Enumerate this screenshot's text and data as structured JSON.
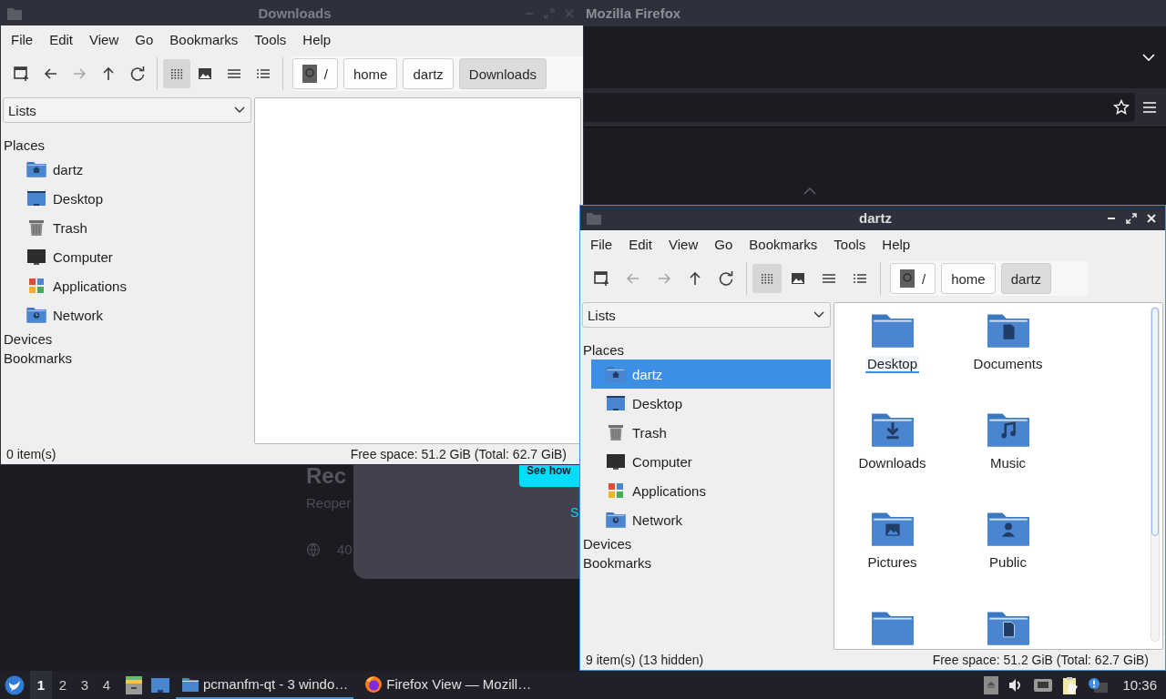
{
  "firefox": {
    "title": "Mozilla Firefox",
    "page": {
      "heading": "Rec",
      "subtitle": "Reoper",
      "count": "40",
      "popup": {
        "button": "See how",
        "link": "S"
      }
    }
  },
  "file_windows": [
    {
      "title": "Downloads",
      "active": false,
      "menu": [
        "File",
        "Edit",
        "View",
        "Go",
        "Bookmarks",
        "Tools",
        "Help"
      ],
      "nav": {
        "back_enabled": true,
        "forward_enabled": false
      },
      "view_buttons": [
        {
          "selected": true
        },
        {
          "selected": false
        },
        {
          "selected": false
        },
        {
          "selected": false
        }
      ],
      "path": [
        {
          "label": "/",
          "selected": false
        },
        {
          "label": "home",
          "selected": false
        },
        {
          "label": "dartz",
          "selected": false
        },
        {
          "label": "Downloads",
          "selected": true
        }
      ],
      "sidebar": {
        "combo": "Lists",
        "places_label": "Places",
        "places": [
          {
            "label": "dartz",
            "kind": "home",
            "selected": false
          },
          {
            "label": "Desktop",
            "kind": "desktop",
            "selected": false
          },
          {
            "label": "Trash",
            "kind": "trash",
            "selected": false
          },
          {
            "label": "Computer",
            "kind": "computer",
            "selected": false
          },
          {
            "label": "Applications",
            "kind": "applications",
            "selected": false
          },
          {
            "label": "Network",
            "kind": "network",
            "selected": false
          }
        ],
        "sections": [
          "Devices",
          "Bookmarks"
        ]
      },
      "status": {
        "count": "0 item(s)",
        "free": "Free space: 51.2 GiB (Total: 62.7 GiB)"
      }
    },
    {
      "title": "dartz",
      "active": true,
      "menu": [
        "File",
        "Edit",
        "View",
        "Go",
        "Bookmarks",
        "Tools",
        "Help"
      ],
      "nav": {
        "back_enabled": false,
        "forward_enabled": false
      },
      "view_buttons": [
        {
          "selected": true
        },
        {
          "selected": false
        },
        {
          "selected": false
        },
        {
          "selected": false
        }
      ],
      "path": [
        {
          "label": "/",
          "selected": false
        },
        {
          "label": "home",
          "selected": false
        },
        {
          "label": "dartz",
          "selected": true
        }
      ],
      "sidebar": {
        "combo": "Lists",
        "places_label": "Places",
        "places": [
          {
            "label": "dartz",
            "kind": "home",
            "selected": true
          },
          {
            "label": "Desktop",
            "kind": "desktop",
            "selected": false
          },
          {
            "label": "Trash",
            "kind": "trash",
            "selected": false
          },
          {
            "label": "Computer",
            "kind": "computer",
            "selected": false
          },
          {
            "label": "Applications",
            "kind": "applications",
            "selected": false
          },
          {
            "label": "Network",
            "kind": "network",
            "selected": false
          }
        ],
        "sections": [
          "Devices",
          "Bookmarks"
        ]
      },
      "files": [
        {
          "name": "Desktop",
          "kind": "desktop",
          "focused": true
        },
        {
          "name": "Documents",
          "kind": "documents",
          "focused": false
        },
        {
          "name": "Downloads",
          "kind": "downloads",
          "focused": false
        },
        {
          "name": "Music",
          "kind": "music",
          "focused": false
        },
        {
          "name": "Pictures",
          "kind": "pictures",
          "focused": false
        },
        {
          "name": "Public",
          "kind": "public",
          "focused": false
        },
        {
          "kind": "folder"
        },
        {
          "kind": "templates"
        }
      ],
      "status": {
        "count": "9 item(s) (13 hidden)",
        "free": "Free space: 51.2 GiB (Total: 62.7 GiB)"
      }
    }
  ],
  "taskbar": {
    "workspaces": [
      {
        "label": "1",
        "selected": true
      },
      {
        "label": "2",
        "selected": false
      },
      {
        "label": "3",
        "selected": false
      },
      {
        "label": "4",
        "selected": false
      }
    ],
    "tasks": [
      {
        "label": "pcmanfm-qt - 3 windo…",
        "kind": "folder",
        "selected": true
      },
      {
        "label": "Firefox View — Mozill…",
        "kind": "firefox",
        "selected": false
      }
    ],
    "clock": "10:36"
  }
}
